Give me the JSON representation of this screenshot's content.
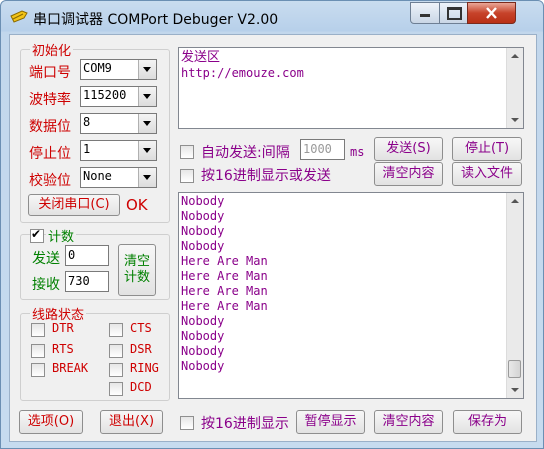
{
  "window": {
    "title": "串口调试器 COMPort Debuger V2.00"
  },
  "init_group": {
    "title": "初始化",
    "port_label": "端口号",
    "port_value": "COM9",
    "baud_label": "波特率",
    "baud_value": "115200",
    "databits_label": "数据位",
    "databits_value": "8",
    "stopbits_label": "停止位",
    "stopbits_value": "1",
    "parity_label": "校验位",
    "parity_value": "None",
    "close_port_label": "关闭串口(C)",
    "status_text": "OK"
  },
  "count_group": {
    "title": "计数",
    "send_label": "发送",
    "send_value": "0",
    "recv_label": "接收",
    "recv_value": "730",
    "clear_label_1": "清空",
    "clear_label_2": "计数"
  },
  "line_group": {
    "title": "线路状态",
    "signals": [
      "DTR",
      "CTS",
      "RTS",
      "DSR",
      "BREAK",
      "RING",
      "DCD"
    ]
  },
  "send_area": {
    "lines": [
      "发送区",
      "http://emouze.com"
    ]
  },
  "send_controls": {
    "auto_send_label": "自动发送:间隔",
    "interval_value": "1000",
    "interval_unit": "ms",
    "hex_send_label": "按16进制显示或发送",
    "send_button": "发送(S)",
    "stop_button": "停止(T)",
    "clear_button": "清空内容",
    "read_file_button": "读入文件"
  },
  "receive_area": {
    "lines": [
      "Nobody",
      "Nobody",
      "Nobody",
      "Nobody",
      "Here Are Man",
      "Here Are Man",
      "Here Are Man",
      "Here Are Man",
      "Nobody",
      "Nobody",
      "Nobody",
      "Nobody"
    ]
  },
  "bottom_bar": {
    "options_button": "选项(O)",
    "exit_button": "退出(X)",
    "hex_display_label": "按16进制显示",
    "pause_button": "暂停显示",
    "clear_button": "清空内容",
    "save_button": "保存为"
  }
}
